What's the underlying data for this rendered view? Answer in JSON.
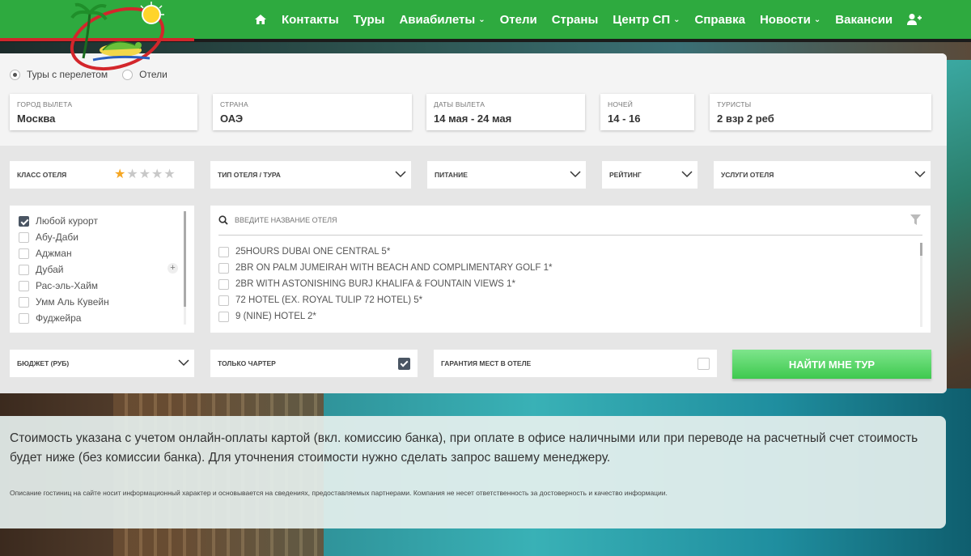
{
  "nav": {
    "items": [
      {
        "label": "Контакты",
        "dropdown": false
      },
      {
        "label": "Туры",
        "dropdown": false
      },
      {
        "label": "Авиабилеты",
        "dropdown": true
      },
      {
        "label": "Отели",
        "dropdown": false
      },
      {
        "label": "Страны",
        "dropdown": false
      },
      {
        "label": "Центр СП",
        "dropdown": true
      },
      {
        "label": "Справка",
        "dropdown": false
      },
      {
        "label": "Новости",
        "dropdown": true
      },
      {
        "label": "Вакансии",
        "dropdown": false
      }
    ],
    "home_icon": "home-icon",
    "user_icon": "add-user-icon"
  },
  "search": {
    "mode_tours": "Туры с перелетом",
    "mode_hotels": "Отели",
    "departure_city": {
      "caption": "ГОРОД ВЫЛЕТА",
      "value": "Москва"
    },
    "country": {
      "caption": "СТРАНА",
      "value": "ОАЭ"
    },
    "dates": {
      "caption": "ДАТЫ ВЫЛЕТА",
      "value": "14 мая - 24 мая"
    },
    "nights": {
      "caption": "НОЧЕЙ",
      "value": "14 - 16"
    },
    "tourists": {
      "caption": "ТУРИСТЫ",
      "value": "2 взр 2 реб"
    }
  },
  "filters": {
    "hotel_class": "КЛАСС ОТЕЛЯ",
    "hotel_class_stars_selected": 1,
    "hotel_type": "ТИП ОТЕЛЯ / ТУРА",
    "meal": "ПИТАНИЕ",
    "rating": "РЕЙТИНГ",
    "services": "УСЛУГИ ОТЕЛЯ",
    "budget": "БЮДЖЕТ (РУБ)",
    "charter_only": "ТОЛЬКО ЧАРТЕР",
    "guarantee": "ГАРАНТИЯ МЕСТ В ОТЕЛЕ"
  },
  "resorts": [
    {
      "label": "Любой курорт",
      "checked": true
    },
    {
      "label": "Абу-Даби",
      "checked": false
    },
    {
      "label": "Аджман",
      "checked": false
    },
    {
      "label": "Дубай",
      "checked": false
    },
    {
      "label": "Рас-эль-Хайм",
      "checked": false
    },
    {
      "label": "Умм Аль Кувейн",
      "checked": false
    },
    {
      "label": "Фуджейра",
      "checked": false
    }
  ],
  "hotel_search_placeholder": "ВВЕДИТЕ НАЗВАНИЕ ОТЕЛЯ",
  "hotels": [
    "25HOURS DUBAI ONE CENTRAL 5*",
    "2BR ON PALM JUMEIRAH WITH BEACH AND COMPLIMENTARY GOLF 1*",
    "2BR WITH ASTONISHING BURJ KHALIFA & FOUNTAIN VIEWS 1*",
    "72 HOTEL (EX. ROYAL TULIP 72 HOTEL) 5*",
    "9 (NINE) HOTEL 2*"
  ],
  "find_button": "НАЙТИ МНЕ ТУР",
  "info": {
    "main": "Стоимость указана с учетом онлайн-оплаты картой (вкл. комиссию банка), при оплате в офисе наличными или при переводе на расчетный счет стоимость будет ниже (без комиссии банка). Для уточнения стоимости нужно сделать запрос вашему менеджеру.",
    "small": "Описание гостиниц на сайте носит информационный характер и основывается на сведениях, предоставляемых партнерами. Компания не несет ответственность за достоверность и качество информации."
  }
}
